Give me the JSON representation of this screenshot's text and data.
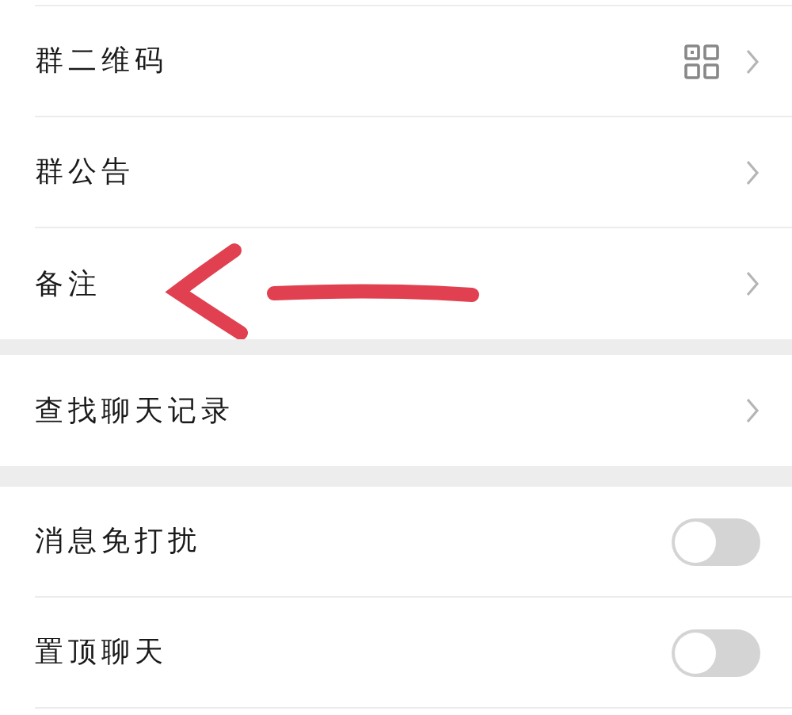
{
  "sections": [
    {
      "items": [
        {
          "label": "群二维码",
          "kind": "qr",
          "annotated": false
        },
        {
          "label": "群公告",
          "kind": "link",
          "annotated": false
        },
        {
          "label": "备注",
          "kind": "link",
          "annotated": true
        }
      ]
    },
    {
      "items": [
        {
          "label": "查找聊天记录",
          "kind": "link",
          "annotated": false
        }
      ]
    },
    {
      "items": [
        {
          "label": "消息免打扰",
          "kind": "toggle",
          "on": false,
          "annotated": false
        },
        {
          "label": "置顶聊天",
          "kind": "toggle",
          "on": false,
          "annotated": false
        }
      ]
    }
  ]
}
